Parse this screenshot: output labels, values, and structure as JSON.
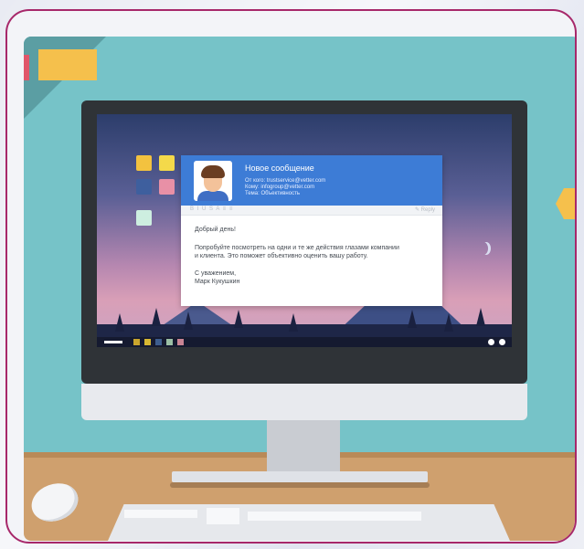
{
  "email": {
    "title": "Новое сообщение",
    "from": "От кого: trustservice@vetter.com",
    "to": "Кому: infogroup@vetter.com",
    "subject": "Тема: Объективность",
    "toolbar_left": "B I U S A ≡ ≡",
    "toolbar_right": "✎ Reply",
    "greeting": "Добрый день!",
    "body_line1": "Попробуйте посмотреть на одни и те же действия глазами компании",
    "body_line2": "и клиента. Это поможет объективно оценить вашу работу.",
    "signoff": "С уважением,",
    "signature": "Марк Кукушкин"
  },
  "colors": {
    "frame_border": "#a7286a",
    "wall": "#76c3c8",
    "email_header": "#3d7cd6",
    "accent_yellow": "#f5c04c"
  },
  "icons": {
    "desktop": [
      "yellow-tile-icon",
      "yellow-tile-icon",
      "blue-tile-icon",
      "pink-tile-icon",
      "mint-tile-icon"
    ],
    "avatar": "man-avatar-icon"
  }
}
